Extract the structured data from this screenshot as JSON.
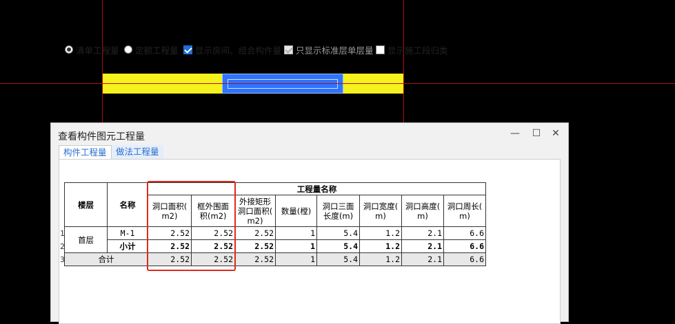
{
  "dialog": {
    "title": "查看构件图元工程量",
    "minimize_glyph": "—",
    "maximize_glyph": "☐",
    "close_glyph": "✕"
  },
  "tabs": [
    {
      "label": "构件工程量",
      "active": true
    },
    {
      "label": "做法工程量",
      "active": false
    }
  ],
  "options": {
    "radio_qingdan": "清单工程量",
    "radio_ding_e": "定额工程量",
    "chk_show_room": "显示房间、组合构件量",
    "chk_standard_floor": "只显示标准层单层量",
    "chk_show_stage": "显示施工段归类"
  },
  "table": {
    "col_floor": "楼层",
    "col_name": "名称",
    "group_header": "工程量名称",
    "columns": [
      "洞口面积(m2)",
      "框外围面积(m2)",
      "外接矩形洞口面积(m2)",
      "数量(樘)",
      "洞口三面长度(m)",
      "洞口宽度(m)",
      "洞口高度(m)",
      "洞口周长(m)"
    ],
    "col_lines": [
      [
        "洞口面积(",
        "m2)"
      ],
      [
        "框外围面",
        "积(m2)"
      ],
      [
        "外接矩形",
        "洞口面积(",
        "m2)"
      ],
      [
        "数量(樘)"
      ],
      [
        "洞口三面",
        "长度(m)"
      ],
      [
        "洞口宽度(",
        "m)"
      ],
      [
        "洞口高度(",
        "m)"
      ],
      [
        "洞口周长(",
        "m)"
      ]
    ],
    "row_numbers": [
      "1",
      "2",
      "3"
    ],
    "floor_value": "首层",
    "rows": [
      {
        "name": "M-1",
        "values": [
          "2.52",
          "2.52",
          "2.52",
          "1",
          "5.4",
          "1.2",
          "2.1",
          "6.6"
        ]
      },
      {
        "name": "小计",
        "values": [
          "2.52",
          "2.52",
          "2.52",
          "1",
          "5.4",
          "1.2",
          "2.1",
          "6.6"
        ]
      }
    ],
    "total": {
      "label": "合计",
      "values": [
        "2.52",
        "2.52",
        "2.52",
        "1",
        "5.4",
        "1.2",
        "2.1",
        "6.6"
      ]
    }
  },
  "colors": {
    "background": "#000000",
    "wall": "#f5f21e",
    "door": "#2f74ff",
    "axis_line": "#b01010",
    "highlight": "#e0281c"
  }
}
